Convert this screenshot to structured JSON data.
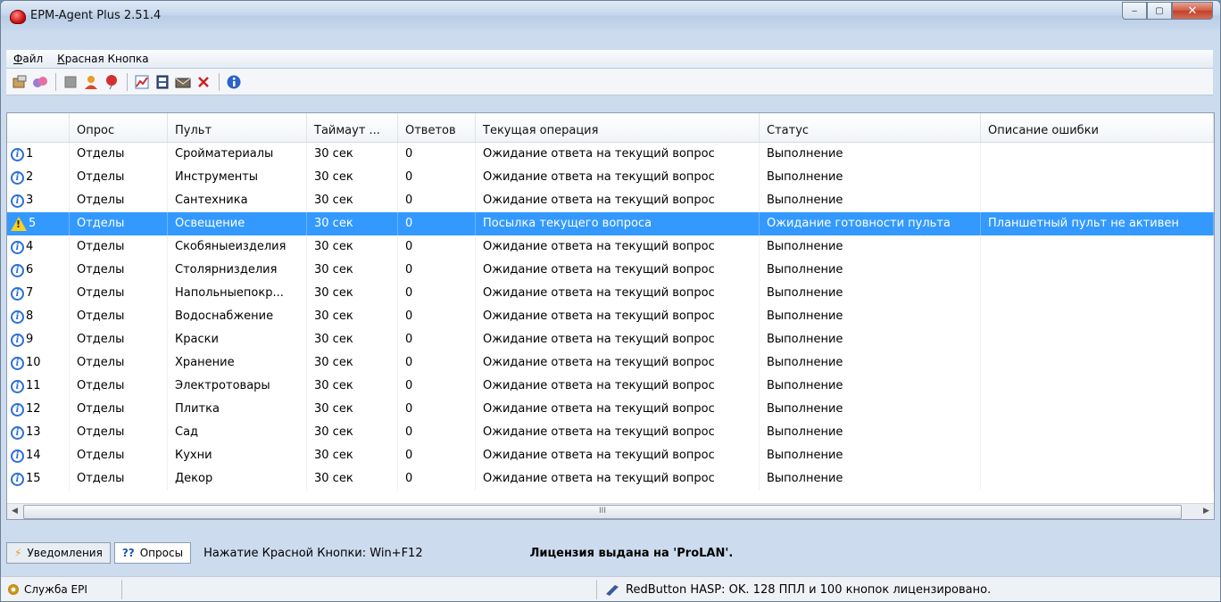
{
  "window": {
    "title": "EPM-Agent Plus 2.51.4",
    "minimize": "‒",
    "maximize": "▢",
    "close": "✕"
  },
  "menu": [
    "Файл",
    "Красная Кнопка"
  ],
  "toolbar_icons": [
    "settings-icon",
    "tags-icon",
    "disabled-icon",
    "user-icon",
    "balloon-icon",
    "chart-icon",
    "film-icon",
    "envelope-icon",
    "pin-icon",
    "info-icon"
  ],
  "table": {
    "headers": [
      "",
      "Опрос",
      "Пульт",
      "Таймаут ...",
      "Ответов",
      "Текущая операция",
      "Статус",
      "Описание ошибки"
    ],
    "rows": [
      {
        "icon": "info",
        "num": "1",
        "poll": "Отделы",
        "remote": "Сройматериалы",
        "timeout": "30 сек",
        "answers": "0",
        "op": "Ожидание ответа на текущий вопрос",
        "status": "Выполнение",
        "error": ""
      },
      {
        "icon": "info",
        "num": "2",
        "poll": "Отделы",
        "remote": "Инструменты",
        "timeout": "30 сек",
        "answers": "0",
        "op": "Ожидание ответа на текущий вопрос",
        "status": "Выполнение",
        "error": ""
      },
      {
        "icon": "info",
        "num": "3",
        "poll": "Отделы",
        "remote": "Сантехника",
        "timeout": "30 сек",
        "answers": "0",
        "op": "Ожидание ответа на текущий вопрос",
        "status": "Выполнение",
        "error": ""
      },
      {
        "icon": "warning",
        "num": "5",
        "poll": "Отделы",
        "remote": "Освещение",
        "timeout": "30 сек",
        "answers": "0",
        "op": "Посылка текущего вопроса",
        "status": "Ожидание готовности пульта",
        "error": "Планшетный пульт не активен",
        "selected": true
      },
      {
        "icon": "info",
        "num": "4",
        "poll": "Отделы",
        "remote": "Скобяныеизделия",
        "timeout": "30 сек",
        "answers": "0",
        "op": "Ожидание ответа на текущий вопрос",
        "status": "Выполнение",
        "error": ""
      },
      {
        "icon": "info",
        "num": "6",
        "poll": "Отделы",
        "remote": "Столярнизделия",
        "timeout": "30 сек",
        "answers": "0",
        "op": "Ожидание ответа на текущий вопрос",
        "status": "Выполнение",
        "error": ""
      },
      {
        "icon": "info",
        "num": "7",
        "poll": "Отделы",
        "remote": "Напольныепокр...",
        "timeout": "30 сек",
        "answers": "0",
        "op": "Ожидание ответа на текущий вопрос",
        "status": "Выполнение",
        "error": ""
      },
      {
        "icon": "info",
        "num": "8",
        "poll": "Отделы",
        "remote": "Водоснабжение",
        "timeout": "30 сек",
        "answers": "0",
        "op": "Ожидание ответа на текущий вопрос",
        "status": "Выполнение",
        "error": ""
      },
      {
        "icon": "info",
        "num": "9",
        "poll": "Отделы",
        "remote": "Краски",
        "timeout": "30 сек",
        "answers": "0",
        "op": "Ожидание ответа на текущий вопрос",
        "status": "Выполнение",
        "error": ""
      },
      {
        "icon": "info",
        "num": "10",
        "poll": "Отделы",
        "remote": "Хранение",
        "timeout": "30 сек",
        "answers": "0",
        "op": "Ожидание ответа на текущий вопрос",
        "status": "Выполнение",
        "error": ""
      },
      {
        "icon": "info",
        "num": "11",
        "poll": "Отделы",
        "remote": "Электротовары",
        "timeout": "30 сек",
        "answers": "0",
        "op": "Ожидание ответа на текущий вопрос",
        "status": "Выполнение",
        "error": ""
      },
      {
        "icon": "info",
        "num": "12",
        "poll": "Отделы",
        "remote": "Плитка",
        "timeout": "30 сек",
        "answers": "0",
        "op": "Ожидание ответа на текущий вопрос",
        "status": "Выполнение",
        "error": ""
      },
      {
        "icon": "info",
        "num": "13",
        "poll": "Отделы",
        "remote": "Сад",
        "timeout": "30 сек",
        "answers": "0",
        "op": "Ожидание ответа на текущий вопрос",
        "status": "Выполнение",
        "error": ""
      },
      {
        "icon": "info",
        "num": "14",
        "poll": "Отделы",
        "remote": "Кухни",
        "timeout": "30 сек",
        "answers": "0",
        "op": "Ожидание ответа на текущий вопрос",
        "status": "Выполнение",
        "error": ""
      },
      {
        "icon": "info",
        "num": "15",
        "poll": "Отделы",
        "remote": "Декор",
        "timeout": "30 сек",
        "answers": "0",
        "op": "Ожидание ответа на текущий вопрос",
        "status": "Выполнение",
        "error": ""
      }
    ]
  },
  "scrollbar": {
    "grip": "III"
  },
  "tabs": {
    "notifications": {
      "icon": "lightning-icon",
      "label": "Уведомления"
    },
    "polls": {
      "icon": "??",
      "label": "Опросы"
    }
  },
  "hint": "Нажатие Красной Кнопки: Win+F12",
  "license": "Лицензия выдана на 'ProLAN'.",
  "statusbar": {
    "service": "Служба EPI",
    "hasp": "RedButton HASP: OK. 128 ППЛ и 100 кнопок лицензировано."
  },
  "colors": {
    "selection": "#3399ff",
    "info": "#2a6fd8",
    "warning": "#f7d21e"
  }
}
